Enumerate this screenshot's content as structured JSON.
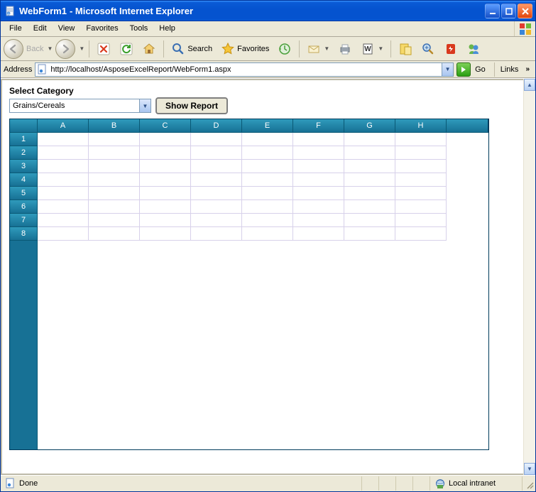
{
  "window": {
    "title_doc": "WebForm1",
    "title_app": "- Microsoft Internet Explorer"
  },
  "menu": {
    "items": [
      "File",
      "Edit",
      "View",
      "Favorites",
      "Tools",
      "Help"
    ]
  },
  "toolbar": {
    "back": "Back",
    "search": "Search",
    "favorites": "Favorites"
  },
  "address": {
    "label": "Address",
    "url": "http://localhost/AsposeExcelReport/WebForm1.aspx",
    "go": "Go",
    "links": "Links"
  },
  "page": {
    "select_label": "Select Category",
    "selected": "Grains/Cereals",
    "button": "Show Report",
    "columns": [
      "A",
      "B",
      "C",
      "D",
      "E",
      "F",
      "G",
      "H"
    ],
    "rows": [
      "1",
      "2",
      "3",
      "4",
      "5",
      "6",
      "7",
      "8"
    ]
  },
  "status": {
    "left": "Done",
    "right": "Local intranet"
  }
}
